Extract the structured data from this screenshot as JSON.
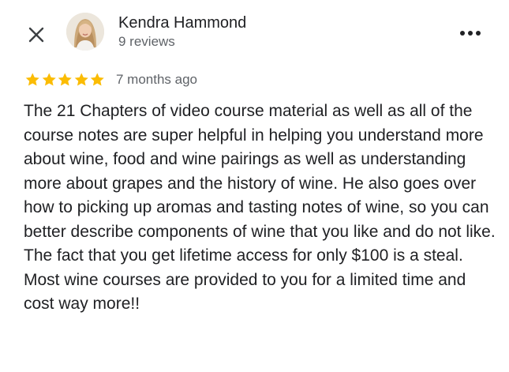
{
  "review": {
    "reviewer_name": "Kendra Hammond",
    "review_count": "9 reviews",
    "rating": 5,
    "rating_max": 5,
    "star_color": "#fbbc04",
    "time_ago": "7 months ago",
    "text": "The 21 Chapters of video course material as well as all of the course notes are super helpful in helping you understand more about wine, food and wine pairings as well as understanding more about grapes and the history of wine. He also goes over how to picking up aromas and tasting notes of wine, so you can better describe components of wine that you like and do not like. The fact that you get lifetime access for only $100 is a steal. Most wine courses are provided to you for a limited time and cost way more!!"
  },
  "icons": {
    "close": "close-icon",
    "more": "more-vert-icon",
    "star": "star-icon"
  }
}
